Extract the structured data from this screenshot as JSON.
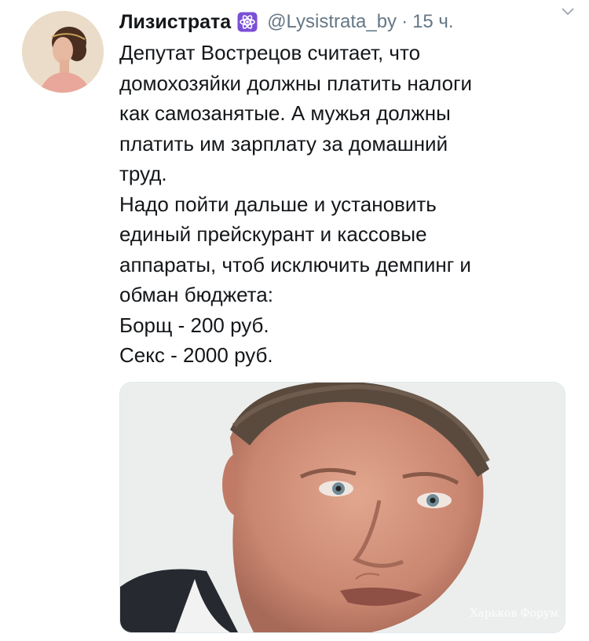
{
  "tweet": {
    "author_name": "Лизистрата",
    "verified_badge_icon": "atom-icon",
    "handle": "@Lysistrata_by",
    "separator": "·",
    "time": "15 ч.",
    "menu_icon": "chevron-down-icon",
    "text_lines": [
      "Депутат Вострецов считает, что",
      "домохозяйки должны платить налоги",
      "как самозанятые. А мужья должны",
      "платить им зарплату за домашний",
      "труд.",
      "Надо пойти дальше и установить",
      "единый прейскурант и кассовые",
      "аппараты, чтоб исключить демпинг и",
      "обман бюджета:",
      "Борщ - 200 руб.",
      "Секс - 2000 руб."
    ]
  },
  "media": {
    "watermark": "Харьков Форум"
  },
  "colors": {
    "text": "#14171a",
    "secondary": "#657786",
    "badge": "#7b4fd6"
  }
}
